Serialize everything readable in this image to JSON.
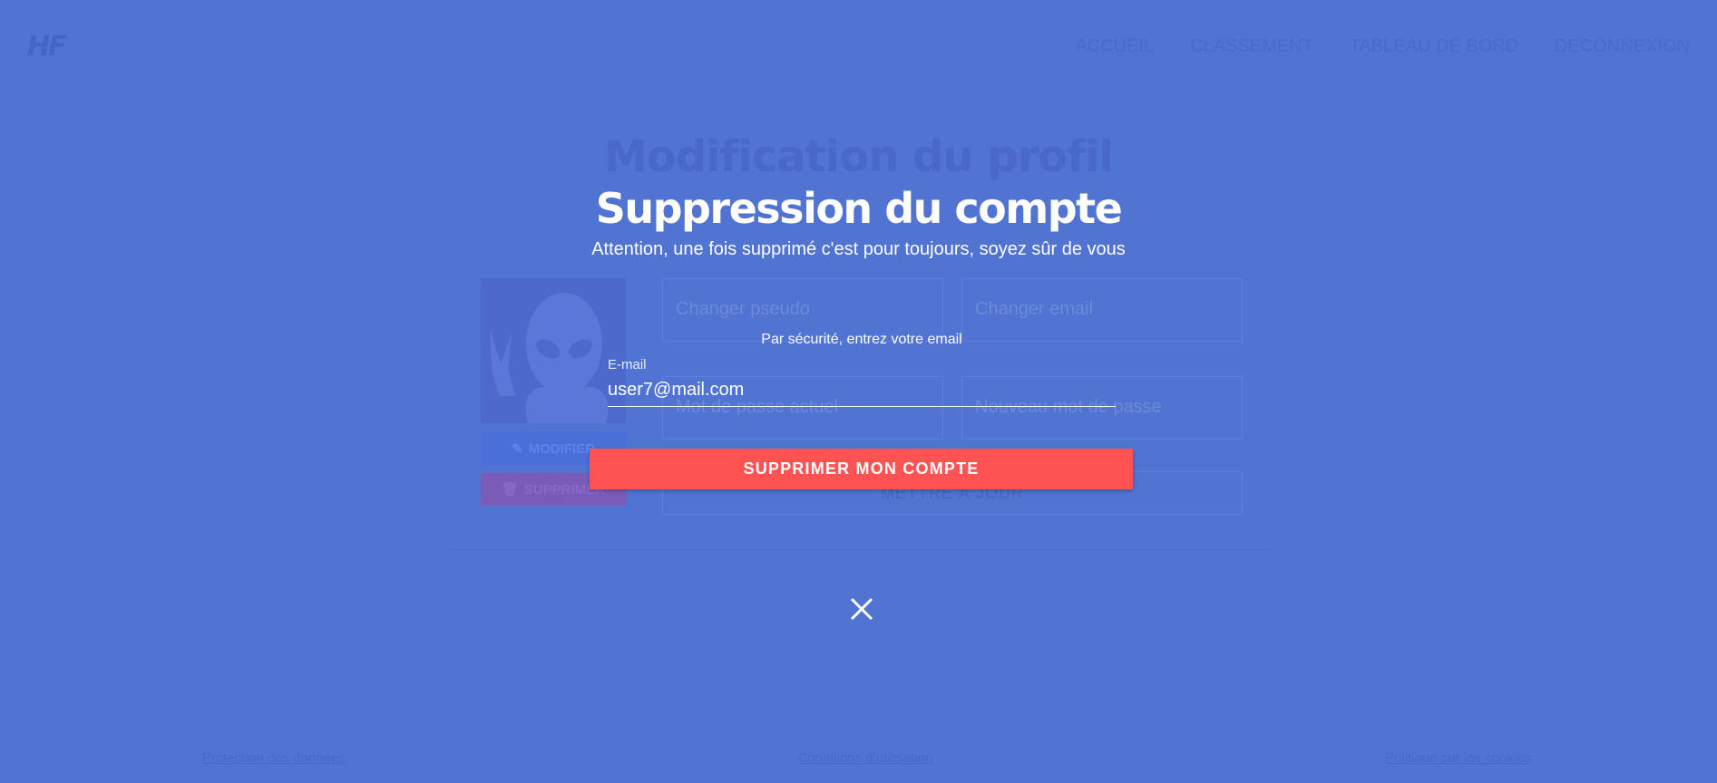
{
  "header": {
    "logo": "HF",
    "nav": [
      "ACCUEIL",
      "CLASSEMENT",
      "TABLEAU DE BORD",
      "DECONNEXION"
    ]
  },
  "profile": {
    "title": "Modification du profil",
    "modify_label": "MODIFIER",
    "delete_label": "SUPPRIMER",
    "fields": {
      "username_placeholder": "Changer pseudo",
      "email_placeholder": "Changer email",
      "current_password_placeholder": "Mot de passe actuel",
      "new_password_placeholder": "Nouveau mot de passe"
    },
    "update_label": "METTRE À JOUR"
  },
  "footer": {
    "links": [
      "Protection des données",
      "Conditions d'utilisation",
      "Politique sur les cookies"
    ]
  },
  "modal": {
    "title": "Suppression du compte",
    "subtitle": "Attention, une fois supprimé c'est pour toujours, soyez sûr de vous",
    "security_text": "Par sécurité, entrez votre email",
    "email_label": "E-mail",
    "email_value": "user7@mail.com",
    "delete_button": "SUPPRIMER MON COMPTE"
  },
  "colors": {
    "background": "#5173d2",
    "danger": "#ff5252",
    "text": "#ffffff"
  }
}
